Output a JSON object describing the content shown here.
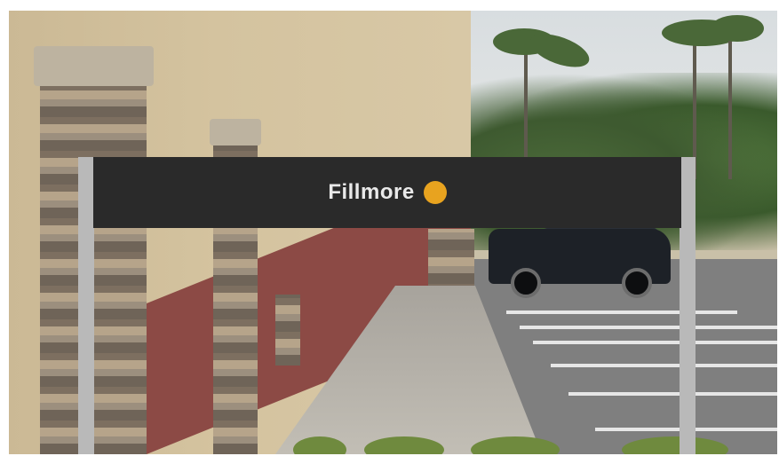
{
  "sign": {
    "label": "Fillmore",
    "dot_color": "#e8a31f"
  }
}
